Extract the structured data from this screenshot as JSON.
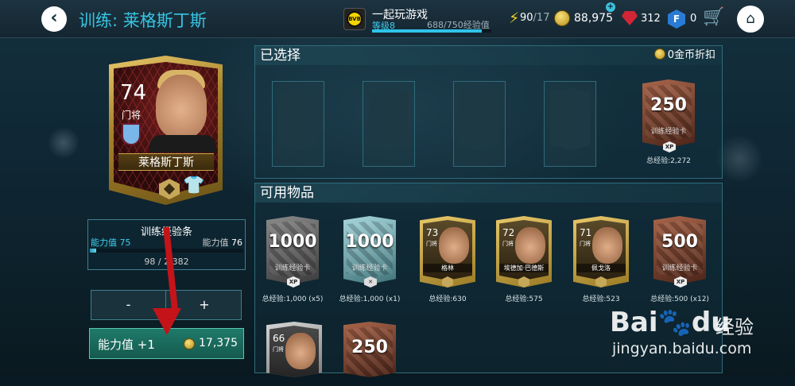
{
  "header": {
    "title": "训练: 莱格斯丁斯",
    "user_name": "一起玩游戏",
    "level_label": "等级8",
    "xp_text": "688/750经验值",
    "xp_progress": 0.917,
    "energy_current": "90",
    "energy_max": "/17",
    "coins": "88,975",
    "gems": "312",
    "points": "0",
    "points_icon_letter": "F"
  },
  "player": {
    "rating": "74",
    "position": "门将",
    "name": "莱格斯丁斯"
  },
  "training": {
    "title": "训练经验条",
    "ability_left_label": "能力值",
    "ability_left_value": "75",
    "ability_right_label": "能力值",
    "ability_right_value": "76",
    "progress_text": "98 / 2,382",
    "progress_fraction": 0.041,
    "minus_label": "-",
    "plus_label": "+",
    "upgrade_label": "能力值 +1",
    "upgrade_cost": "17,375"
  },
  "selected": {
    "header": "已选择",
    "discount": "0金币折扣",
    "card_value": "250",
    "card_label": "训练经验卡",
    "card_xp": "XP",
    "total_xp": "总经验:2,272"
  },
  "available": {
    "header": "可用物品",
    "items": [
      {
        "value": "1000",
        "label": "训练经验卡",
        "chip": "XP",
        "caption": "总经验:1,000 (x5)"
      },
      {
        "value": "1000",
        "label": "训练经验卡",
        "chip": "",
        "caption": "总经验:1,000 (x1)"
      },
      {
        "rating": "73",
        "pos": "门将",
        "name": "格林",
        "caption": "总经验:630"
      },
      {
        "rating": "72",
        "pos": "门将",
        "name": "埃德加·巴德斯",
        "caption": "总经验:575"
      },
      {
        "rating": "71",
        "pos": "门将",
        "name": "佩戈洛",
        "caption": "总经验:523"
      },
      {
        "value": "500",
        "label": "训练经验卡",
        "chip": "XP",
        "caption": "总经验:500 (x12)"
      },
      {
        "rating": "66",
        "pos": "门将"
      },
      {
        "value": "250"
      }
    ]
  },
  "watermark": {
    "brand": "Bai",
    "brand2": "du",
    "cn": "经验",
    "url": "jingyan.baidu.com"
  },
  "colors": {
    "accent": "#36c5e3",
    "gold": "#caa24b",
    "upgrade_bg": "#1f7a6a",
    "arrow": "#c4141a"
  }
}
